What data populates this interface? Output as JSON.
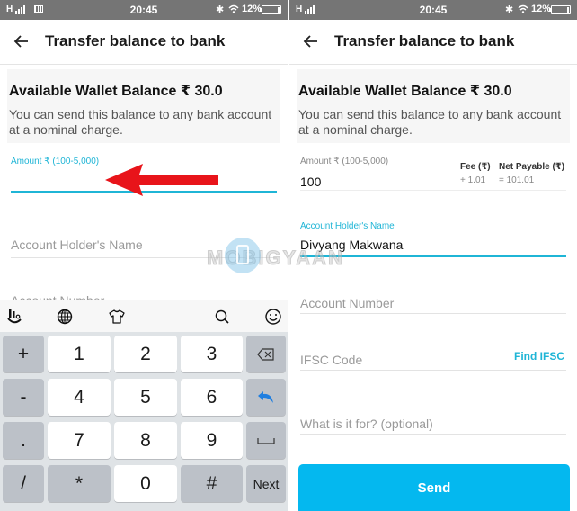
{
  "status_bar": {
    "time": "20:45",
    "battery_percent": "12%",
    "network_label": "H",
    "icons": [
      "signal-icon",
      "keyboard-notification-icon",
      "bluetooth-icon",
      "wifi-icon",
      "battery-icon"
    ]
  },
  "app_bar": {
    "title": "Transfer balance to bank",
    "back_icon": "arrow-left-icon"
  },
  "balance_card": {
    "heading": "Available Wallet Balance ₹ 30.0",
    "description": "You can send this balance to any bank account at a nominal charge."
  },
  "left_screen": {
    "amount_label": "Amount ₹ (100-5,000)",
    "amount_value": "",
    "holder_placeholder": "Account Holder's Name",
    "account_number_placeholder": "Account Number",
    "annotation": "red-arrow pointing to amount field"
  },
  "keyboard": {
    "toolbar_icons": [
      "touchpal-logo-icon",
      "globe-icon",
      "tshirt-theme-icon",
      "search-icon",
      "emoji-icon"
    ],
    "rows": [
      [
        "+",
        "1",
        "2",
        "3",
        "backspace"
      ],
      [
        "-",
        "4",
        "5",
        "6",
        "undo"
      ],
      [
        ".",
        "7",
        "8",
        "9",
        "space"
      ],
      [
        "/",
        "*",
        "0",
        "#",
        "Next"
      ]
    ]
  },
  "right_screen": {
    "amount_label": "Amount ₹ (100-5,000)",
    "amount_value": "100",
    "fee_label": "Fee (₹)",
    "fee_value": "+ 1.01",
    "net_label": "Net Payable (₹)",
    "net_value": "= 101.01",
    "holder_label": "Account Holder's Name",
    "holder_value": "Divyang Makwana",
    "account_number_placeholder": "Account Number",
    "ifsc_placeholder": "IFSC Code",
    "find_ifsc_label": "Find IFSC",
    "purpose_placeholder": "What is it for? (optional)",
    "send_label": "Send"
  },
  "watermark": {
    "text": "MOBIGYAAN"
  },
  "colors": {
    "accent": "#1fb5d6",
    "send_button": "#04b8ef",
    "status_bar": "#757575",
    "annotation_arrow": "#e8141a"
  }
}
